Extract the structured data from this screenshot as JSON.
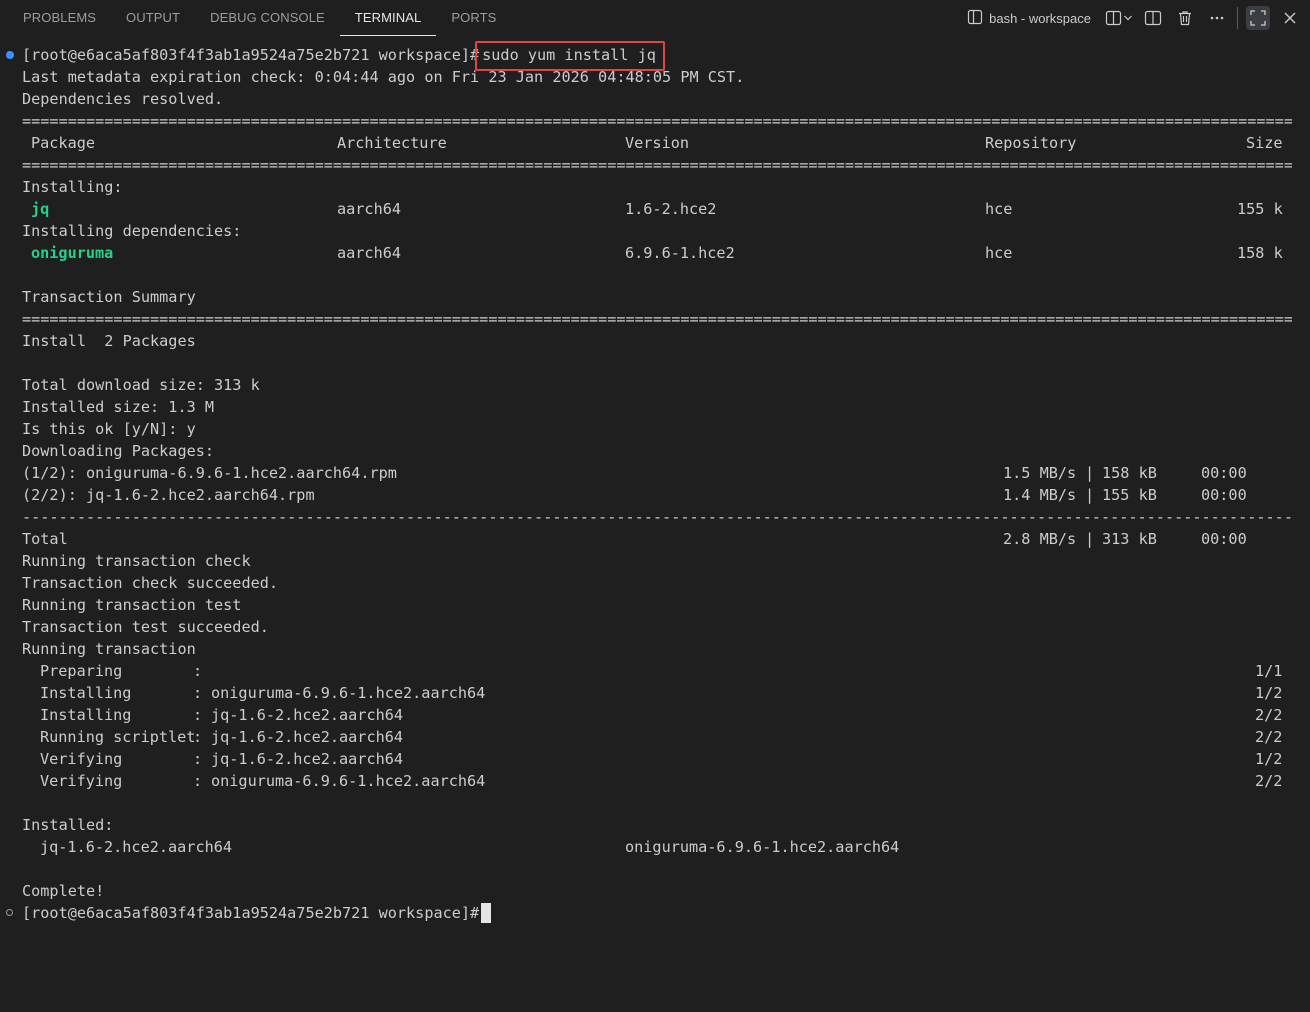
{
  "panel": {
    "tabs": [
      "PROBLEMS",
      "OUTPUT",
      "DEBUG CONSOLE",
      "TERMINAL",
      "PORTS"
    ],
    "active_tab": "TERMINAL",
    "terminal_name": "bash - workspace",
    "toolbar_icons": [
      "terminal-icon",
      "split-terminal-icon",
      "chevron-down-icon",
      "split-editor-icon",
      "trash-icon",
      "more-icon",
      "maximize-panel-icon",
      "close-icon"
    ]
  },
  "terminal": {
    "prompt": "[root@e6aca5af803f4f3ab1a9524a75e2b721 workspace]#",
    "command": " sudo yum install jq",
    "meta_line": "Last metadata expiration check: 0:04:44 ago on Fri 23 Jan 2026 04:48:05 PM CST.",
    "deps_resolved": "Dependencies resolved.",
    "table_headers": {
      "package": "Package",
      "architecture": "Architecture",
      "version": "Version",
      "repository": "Repository",
      "size": "Size"
    },
    "installing_label": "Installing:",
    "installing_deps_label": "Installing dependencies:",
    "packages": [
      {
        "name": "jq",
        "arch": "aarch64",
        "version": "1.6-2.hce2",
        "repo": "hce",
        "size": "155 k"
      },
      {
        "name": "oniguruma",
        "arch": "aarch64",
        "version": "6.9.6-1.hce2",
        "repo": "hce",
        "size": "158 k"
      }
    ],
    "transaction_summary": "Transaction Summary",
    "install_count": "Install  2 Packages",
    "total_download": "Total download size: 313 k",
    "installed_size": "Installed size: 1.3 M",
    "confirm": "Is this ok [y/N]: y",
    "downloading": "Downloading Packages:",
    "downloads": [
      {
        "file": "(1/2): oniguruma-6.9.6-1.hce2.aarch64.rpm",
        "speed": "1.5 MB/s",
        "size": "158 kB",
        "time": "00:00"
      },
      {
        "file": "(2/2): jq-1.6-2.hce2.aarch64.rpm",
        "speed": "1.4 MB/s",
        "size": "155 kB",
        "time": "00:00"
      }
    ],
    "total": {
      "label": "Total",
      "speed": "2.8 MB/s",
      "size": "313 kB",
      "time": "00:00"
    },
    "tx_lines": [
      "Running transaction check",
      "Transaction check succeeded.",
      "Running transaction test",
      "Transaction test succeeded.",
      "Running transaction"
    ],
    "steps": [
      {
        "action": "Preparing",
        "target": "",
        "progress": "1/1"
      },
      {
        "action": "Installing",
        "target": "oniguruma-6.9.6-1.hce2.aarch64",
        "progress": "1/2"
      },
      {
        "action": "Installing",
        "target": "jq-1.6-2.hce2.aarch64",
        "progress": "2/2"
      },
      {
        "action": "Running scriptlet",
        "target": "jq-1.6-2.hce2.aarch64",
        "progress": "2/2"
      },
      {
        "action": "Verifying",
        "target": "jq-1.6-2.hce2.aarch64",
        "progress": "1/2"
      },
      {
        "action": "Verifying",
        "target": "oniguruma-6.9.6-1.hce2.aarch64",
        "progress": "2/2"
      }
    ],
    "installed_label": "Installed:",
    "installed": [
      "jq-1.6-2.hce2.aarch64",
      "oniguruma-6.9.6-1.hce2.aarch64"
    ],
    "complete": "Complete!",
    "colors": {
      "package_name": "#23d18b",
      "highlight_box": "#e04545",
      "marker_blue": "#3794ff"
    }
  }
}
